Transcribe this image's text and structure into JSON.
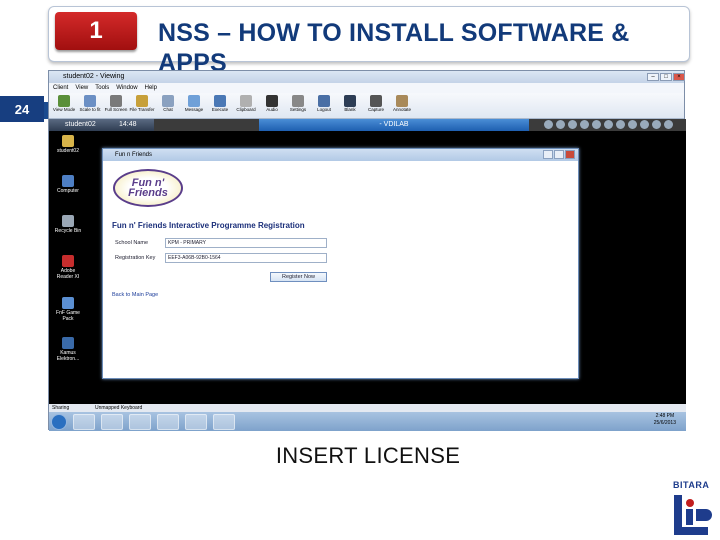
{
  "slide": {
    "number": "1",
    "page": "24",
    "title": "NSS – HOW TO INSTALL SOFTWARE & APPS",
    "caption": "INSERT LICENSE",
    "brand": "BITARA"
  },
  "viewer": {
    "title": "student02 - Viewing",
    "menu": [
      "Client",
      "View",
      "Tools",
      "Window",
      "Help"
    ],
    "tools": [
      "View Mode",
      "Scale to fit",
      "Full Screen",
      "File Transfer",
      "Chat",
      "Message",
      "Execute",
      "Clipboard",
      "Audio",
      "Settings",
      "Logout",
      "Blank",
      "Capture",
      "Annotate"
    ],
    "tab_name": "student02",
    "tab_time": "14:48",
    "tab_center": "- VDILAB",
    "desktop_icons": [
      "student02",
      "Computer",
      "Recycle Bin",
      "Adobe Reader XI",
      "FnF Game Pack",
      "Kamus Elektron..."
    ],
    "status": {
      "left": "Sharing",
      "right": "Unmapped Keyboard"
    },
    "clock": {
      "time": "2:48 PM",
      "date": "25/6/2013"
    }
  },
  "app": {
    "window_title": "Fun n Friends",
    "logo_text": "Fun n' Friends",
    "heading": "Fun n' Friends Interactive Programme Registration",
    "school_label": "School Name",
    "school_value": "KPM - PRIMARY",
    "key_label": "Registration Key",
    "key_value": "EEF3-A06B-92B0-1564",
    "register_btn": "Register Now",
    "back_link": "Back to Main Page"
  },
  "colors": {
    "header_blue": "#123a7a",
    "badge_red": "#c21d1d",
    "band_blue": "#1a4a8f"
  }
}
